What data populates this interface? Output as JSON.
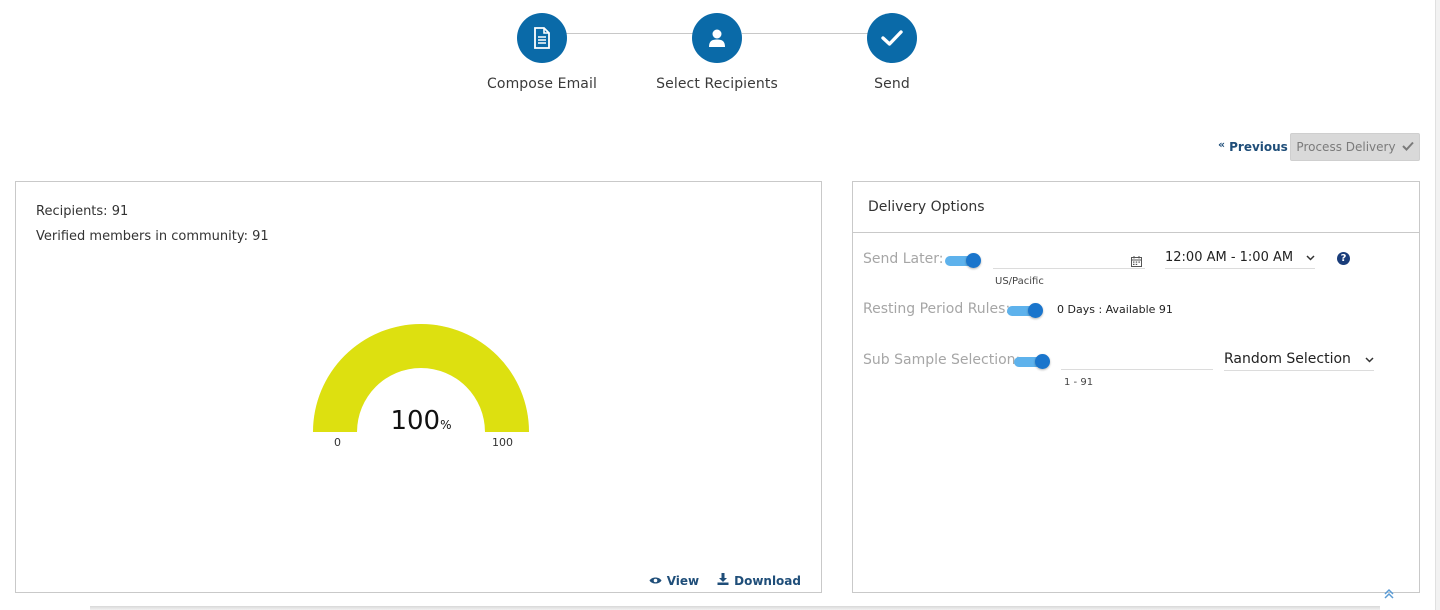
{
  "stepper": {
    "steps": [
      {
        "label": "Compose Email",
        "icon": "document-icon"
      },
      {
        "label": "Select Recipients",
        "icon": "user-icon"
      },
      {
        "label": "Send",
        "icon": "checkmark-icon"
      }
    ]
  },
  "actions": {
    "previous_label": "Previous",
    "process_label": "Process Delivery"
  },
  "summary": {
    "recipients": "Recipients: 91",
    "verified": "Verified members in community: 91"
  },
  "gauge": {
    "value": "100",
    "unit": "%",
    "min": "0",
    "max": "100",
    "fill_fraction": 1.0,
    "color": "#dde010"
  },
  "footer_links": {
    "view": "View",
    "download": "Download"
  },
  "delivery_options": {
    "title": "Delivery Options",
    "send_later": {
      "label": "Send Later:",
      "enabled": true,
      "timezone": "US/Pacific",
      "time_range": "12:00 AM - 1:00 AM"
    },
    "resting_period": {
      "label": "Resting Period Rules:",
      "enabled": true,
      "info": "0 Days : Available 91"
    },
    "sub_sample": {
      "label": "Sub Sample Selection:",
      "enabled": true,
      "range": "1 - 91",
      "method": "Random Selection"
    }
  },
  "colors": {
    "primary": "#0a6aa8",
    "link": "#1f4e79",
    "toggle": "#1a75cc"
  }
}
